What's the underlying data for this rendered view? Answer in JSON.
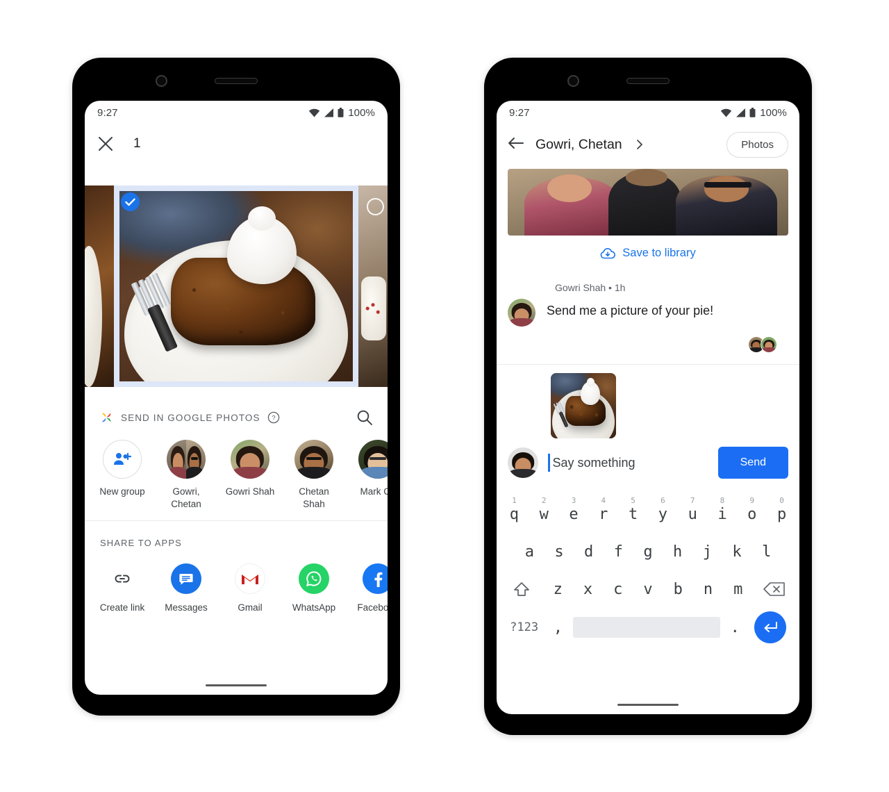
{
  "left_phone": {
    "statusbar": {
      "time": "9:27",
      "battery": "100%",
      "icons": [
        "wifi-icon",
        "cellular-signal-icon",
        "battery-icon"
      ]
    },
    "sheet": {
      "close_icon": "close-icon",
      "selection_count": "1"
    },
    "photo_strip": {
      "selected_photo_alt": "slice of pie with whipped cream",
      "selected": true,
      "check_icon": "check-icon",
      "unselected_icon": "circle-outline-icon"
    },
    "send_section": {
      "logo": "google-photos-logo",
      "title": "SEND IN GOOGLE PHOTOS",
      "help_icon": "help-circle-icon",
      "search_icon": "search-icon"
    },
    "contacts": [
      {
        "name": "New group",
        "type": "new-group",
        "icon": "group-add-icon"
      },
      {
        "name": "Gowri, Chetan",
        "type": "pair"
      },
      {
        "name": "Gowri Shah",
        "type": "person"
      },
      {
        "name": "Chetan Shah",
        "type": "person"
      },
      {
        "name": "Mark Ch",
        "type": "person"
      }
    ],
    "apps_section": {
      "title": "SHARE TO APPS",
      "apps": [
        {
          "name": "Create link",
          "icon": "link-icon",
          "color": "#3c4043"
        },
        {
          "name": "Messages",
          "icon": "messages-icon",
          "color": "#1a73e8"
        },
        {
          "name": "Gmail",
          "icon": "gmail-icon",
          "color": "#ea4335"
        },
        {
          "name": "WhatsApp",
          "icon": "whatsapp-icon",
          "color": "#25d366"
        },
        {
          "name": "Facebook",
          "icon": "facebook-icon",
          "color": "#1877f2"
        }
      ]
    }
  },
  "right_phone": {
    "statusbar": {
      "time": "9:27",
      "battery": "100%"
    },
    "header": {
      "back_icon": "back-arrow-icon",
      "title": "Gowri, Chetan",
      "chevron_icon": "chevron-right-icon",
      "photos_button": "Photos"
    },
    "conversation": {
      "top_photo_alt": "group selfie outdoors",
      "save_to_library": "Save to library",
      "save_icon": "cloud-download-icon",
      "message": {
        "author": "Gowri Shah",
        "separator": "•",
        "time": "1h",
        "text": "Send me a picture of your pie!"
      },
      "read_receipts": 2
    },
    "compose": {
      "attachment_alt": "slice of pie with whipped cream",
      "placeholder": "Say something",
      "send_label": "Send"
    },
    "keyboard": {
      "row1": [
        {
          "key": "q",
          "num": "1"
        },
        {
          "key": "w",
          "num": "2"
        },
        {
          "key": "e",
          "num": "3"
        },
        {
          "key": "r",
          "num": "4"
        },
        {
          "key": "t",
          "num": "5"
        },
        {
          "key": "y",
          "num": "6"
        },
        {
          "key": "u",
          "num": "7"
        },
        {
          "key": "i",
          "num": "8"
        },
        {
          "key": "o",
          "num": "9"
        },
        {
          "key": "p",
          "num": "0"
        }
      ],
      "row2": [
        "a",
        "s",
        "d",
        "f",
        "g",
        "h",
        "j",
        "k",
        "l"
      ],
      "row3": [
        "z",
        "x",
        "c",
        "v",
        "b",
        "n",
        "m"
      ],
      "shift_icon": "shift-icon",
      "backspace_icon": "backspace-icon",
      "symbols_key": "?123",
      "comma_key": ",",
      "period_key": ".",
      "enter_icon": "enter-icon",
      "space_key": ""
    }
  },
  "colors": {
    "accent_blue": "#1a73e8",
    "send_blue": "#1b6ef3",
    "selection_bg": "#dde6f7",
    "text_primary": "#202124",
    "text_secondary": "#5f6368"
  }
}
